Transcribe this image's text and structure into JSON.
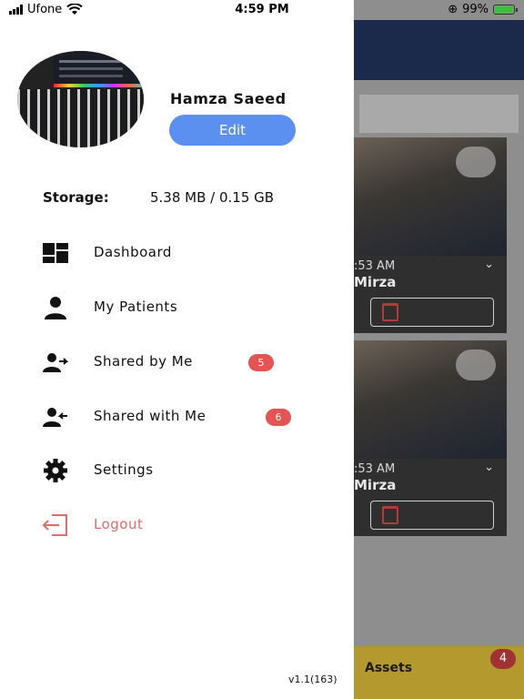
{
  "status_bar": {
    "carrier": "Ufone",
    "time": "4:59 PM",
    "battery": "99%"
  },
  "drawer": {
    "user_name": "Hamza Saeed",
    "edit_label": "Edit",
    "storage_label": "Storage:",
    "storage_value": "5.38 MB / 0.15 GB",
    "menu": [
      {
        "label": "Dashboard",
        "icon": "dashboard-icon"
      },
      {
        "label": "My Patients",
        "icon": "person-icon"
      },
      {
        "label": "Shared by Me",
        "icon": "person-share-out-icon",
        "badge": "5"
      },
      {
        "label": "Shared with Me",
        "icon": "person-share-in-icon",
        "badge": "6"
      },
      {
        "label": "Settings",
        "icon": "gear-icon"
      },
      {
        "label": "Logout",
        "icon": "logout-icon"
      }
    ],
    "version": "v1.1(163)"
  },
  "background": {
    "cards": [
      {
        "time": ":53 AM",
        "name": "Mirza"
      },
      {
        "time": ":53 AM",
        "name": "Mirza"
      }
    ],
    "bottom_tab_label": "Assets",
    "bottom_tab_badge": "4"
  },
  "colors": {
    "accent": "#5b8ff0",
    "badge": "#e55353",
    "logout": "#e56a6a",
    "navy": "#1b2a4b"
  }
}
